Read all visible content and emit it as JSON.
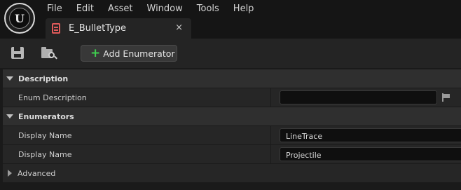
{
  "app": {
    "logo_letter": "U"
  },
  "menu": [
    "File",
    "Edit",
    "Asset",
    "Window",
    "Tools",
    "Help"
  ],
  "tab": {
    "label": "E_BulletType",
    "close": "×"
  },
  "toolbar": {
    "add_label": "Add Enumerator",
    "add_icon": "+"
  },
  "details": {
    "description": {
      "header": "Description",
      "rows": [
        {
          "label": "Enum Description",
          "value": ""
        }
      ]
    },
    "enumerators": {
      "header": "Enumerators",
      "rows": [
        {
          "label": "Display Name",
          "value": "LineTrace"
        },
        {
          "label": "Display Name",
          "value": "Projectile"
        }
      ]
    },
    "advanced": {
      "label": "Advanced"
    }
  }
}
